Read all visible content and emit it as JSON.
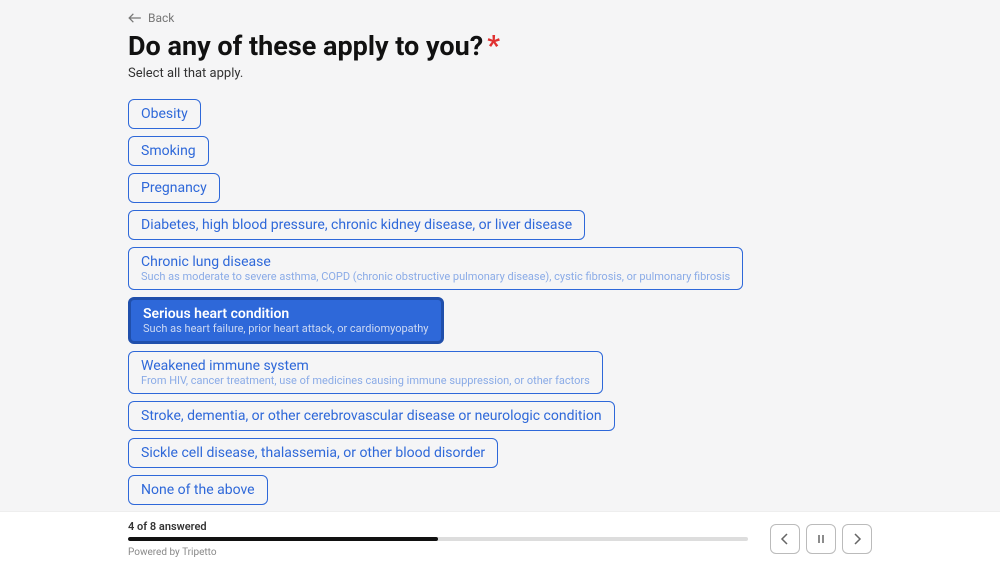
{
  "back_label": "Back",
  "question": "Do any of these apply to you?",
  "required_marker": "*",
  "subtitle": "Select all that apply.",
  "options": [
    {
      "label": "Obesity",
      "description": null,
      "selected": false
    },
    {
      "label": "Smoking",
      "description": null,
      "selected": false
    },
    {
      "label": "Pregnancy",
      "description": null,
      "selected": false
    },
    {
      "label": "Diabetes, high blood pressure, chronic kidney disease, or liver disease",
      "description": null,
      "selected": false
    },
    {
      "label": "Chronic lung disease",
      "description": "Such as moderate to severe asthma, COPD (chronic obstructive pulmonary disease), cystic fibrosis, or pulmonary fibrosis",
      "selected": false
    },
    {
      "label": "Serious heart condition",
      "description": "Such as heart failure, prior heart attack, or cardiomyopathy",
      "selected": true
    },
    {
      "label": "Weakened immune system",
      "description": "From HIV, cancer treatment, use of medicines causing immune suppression, or other factors",
      "selected": false
    },
    {
      "label": "Stroke, dementia, or other cerebrovascular disease or neurologic condition",
      "description": null,
      "selected": false
    },
    {
      "label": "Sickle cell disease, thalassemia, or other blood disorder",
      "description": null,
      "selected": false
    },
    {
      "label": "None of the above",
      "description": null,
      "selected": false
    }
  ],
  "progress": {
    "text": "4 of 8 answered",
    "answered": 4,
    "total": 8,
    "percent": 50
  },
  "powered_by": "Powered by Tripetto"
}
